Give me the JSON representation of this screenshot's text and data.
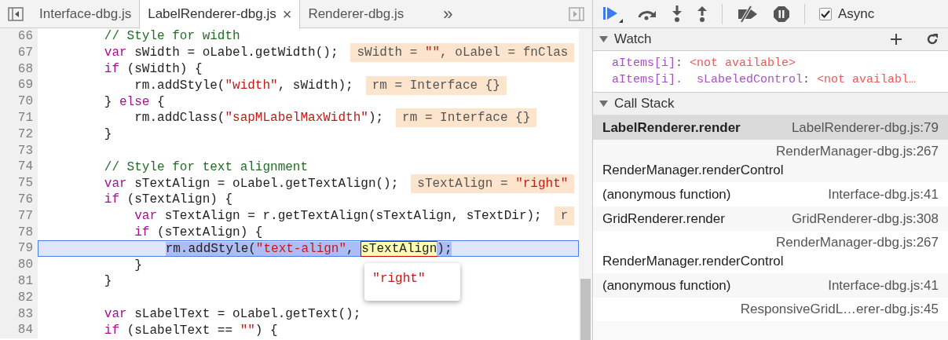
{
  "editor": {
    "tabs": [
      {
        "label": "Interface-dbg.js",
        "selected": false
      },
      {
        "label": "LabelRenderer-dbg.js",
        "selected": true,
        "close": "×"
      },
      {
        "label": "Renderer-dbg.js",
        "selected": false
      }
    ],
    "more": "»",
    "lines": [
      {
        "number": "66",
        "tokens": [
          {
            "kind": "comment",
            "text": "        // Style for width"
          }
        ]
      },
      {
        "number": "67",
        "tokens": [
          {
            "kind": "keyword",
            "text": "        var"
          },
          {
            "kind": "plain",
            "text": " sWidth = oLabel.getWidth();"
          }
        ],
        "annotation": [
          {
            "kind": "plain",
            "text": "sWidth = "
          },
          {
            "kind": "string",
            "text": "\"\""
          },
          {
            "kind": "plain",
            "text": ", oLabel = fnClas"
          }
        ]
      },
      {
        "number": "68",
        "tokens": [
          {
            "kind": "keyword",
            "text": "        if"
          },
          {
            "kind": "plain",
            "text": " (sWidth) {"
          }
        ]
      },
      {
        "number": "69",
        "tokens": [
          {
            "kind": "plain",
            "text": "            rm.addStyle("
          },
          {
            "kind": "string",
            "text": "\"width\""
          },
          {
            "kind": "plain",
            "text": ", sWidth);"
          }
        ],
        "annotation": [
          {
            "kind": "plain",
            "text": "rm = Interface {}"
          }
        ]
      },
      {
        "number": "70",
        "tokens": [
          {
            "kind": "plain",
            "text": "        } "
          },
          {
            "kind": "keyword",
            "text": "else"
          },
          {
            "kind": "plain",
            "text": " {"
          }
        ]
      },
      {
        "number": "71",
        "tokens": [
          {
            "kind": "plain",
            "text": "            rm.addClass("
          },
          {
            "kind": "string",
            "text": "\"sapMLabelMaxWidth\""
          },
          {
            "kind": "plain",
            "text": ");"
          }
        ],
        "annotation": [
          {
            "kind": "plain",
            "text": "rm = Interface {}"
          }
        ]
      },
      {
        "number": "72",
        "tokens": [
          {
            "kind": "plain",
            "text": "        }"
          }
        ]
      },
      {
        "number": "73"
      },
      {
        "number": "74",
        "tokens": [
          {
            "kind": "comment",
            "text": "        // Style for text alignment"
          }
        ]
      },
      {
        "number": "75",
        "tokens": [
          {
            "kind": "keyword",
            "text": "        var"
          },
          {
            "kind": "plain",
            "text": " sTextAlign = oLabel.getTextAlign();"
          }
        ],
        "annotation": [
          {
            "kind": "plain",
            "text": "sTextAlign = "
          },
          {
            "kind": "string",
            "text": "\"right\""
          }
        ]
      },
      {
        "number": "76",
        "tokens": [
          {
            "kind": "keyword",
            "text": "        if"
          },
          {
            "kind": "plain",
            "text": " (sTextAlign) {"
          }
        ]
      },
      {
        "number": "77",
        "tokens": [
          {
            "kind": "keyword",
            "text": "            var"
          },
          {
            "kind": "plain",
            "text": " sTextAlign = r.getTextAlign(sTextAlign, sTextDir);"
          }
        ],
        "annotation": [
          {
            "kind": "plain",
            "text": "r"
          }
        ]
      },
      {
        "number": "78",
        "tokens": [
          {
            "kind": "keyword",
            "text": "            if"
          },
          {
            "kind": "plain",
            "text": " (sTextAlign) {"
          }
        ]
      },
      {
        "number": "79",
        "current": true,
        "tokens": [
          {
            "kind": "plain",
            "text": "                rm.addStyle(",
            "selected": true
          },
          {
            "kind": "string",
            "text": "\"text-align\"",
            "selected": true
          },
          {
            "kind": "plain",
            "text": ", ",
            "selected": true
          },
          {
            "kind": "plain",
            "text": "sTextAlign",
            "selected": true,
            "hovered": true,
            "tooltip": "\"right\""
          },
          {
            "kind": "plain",
            "text": ");",
            "selected": true
          }
        ]
      },
      {
        "number": "80",
        "tokens": [
          {
            "kind": "plain",
            "text": "            }"
          }
        ]
      },
      {
        "number": "81",
        "tokens": [
          {
            "kind": "plain",
            "text": "        }"
          }
        ]
      },
      {
        "number": "82"
      },
      {
        "number": "83",
        "tokens": [
          {
            "kind": "keyword",
            "text": "        var"
          },
          {
            "kind": "plain",
            "text": " sLabelText = oLabel.getText();"
          }
        ]
      },
      {
        "number": "84",
        "tokens": [
          {
            "kind": "keyword",
            "text": "        if"
          },
          {
            "kind": "plain",
            "text": " (sLabelText == "
          },
          {
            "kind": "string",
            "text": "\"\""
          },
          {
            "kind": "plain",
            "text": ") {"
          }
        ]
      }
    ]
  },
  "debugger": {
    "async": {
      "label": "Async",
      "checked": true
    },
    "watch": {
      "title": "Watch",
      "expanded": true,
      "items": [
        {
          "name": "aItems[i]",
          "separator": ":",
          "value": "<not available>"
        },
        {
          "name": "aItems[i].  sLabeledControl",
          "separator": ":",
          "value": "<not availabl…"
        }
      ]
    },
    "call_stack": {
      "title": "Call Stack",
      "expanded": true,
      "frames": [
        {
          "kind": "single",
          "name": "LabelRenderer.render",
          "location": "LabelRenderer-dbg.js:79",
          "selected": true
        },
        {
          "kind": "wrapped",
          "name": "RenderManager.renderControl",
          "location": "RenderManager-dbg.js:267",
          "selected": false
        },
        {
          "kind": "single",
          "name": "(anonymous function)",
          "location": "Interface-dbg.js:41",
          "selected": false
        },
        {
          "kind": "single",
          "name": "GridRenderer.render",
          "location": "GridRenderer-dbg.js:308",
          "selected": false
        },
        {
          "kind": "wrapped",
          "name": "RenderManager.renderControl",
          "location": "RenderManager-dbg.js:267",
          "selected": false
        },
        {
          "kind": "single",
          "name": "(anonymous function)",
          "location": "Interface-dbg.js:41",
          "selected": false
        },
        {
          "kind": "wrapped",
          "location": "ResponsiveGridL…erer-dbg.js:45",
          "selected": false
        }
      ]
    }
  }
}
